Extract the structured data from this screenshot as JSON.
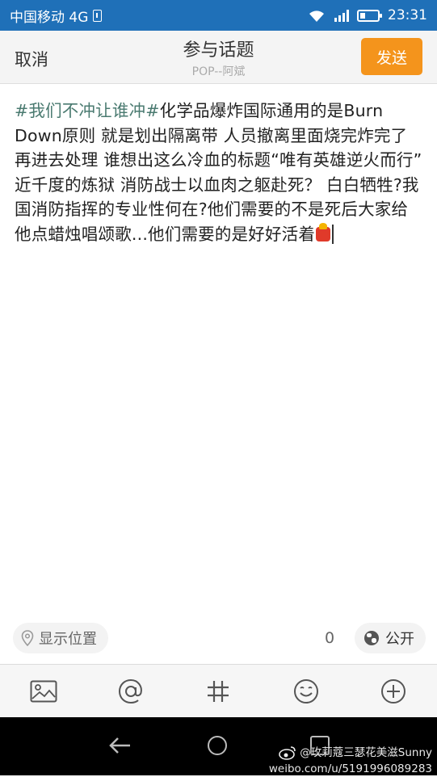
{
  "status_bar": {
    "carrier": "中国移动 4G",
    "network_tag": "4G",
    "time": "23:31",
    "battery_level": 0.3
  },
  "header": {
    "cancel_label": "取消",
    "title": "参与话题",
    "subtitle": "POP--阿斌",
    "send_label": "发送"
  },
  "post": {
    "topic": "#我们不冲让谁冲#",
    "body": "化学品爆炸国际通用的是Burn Down原则 就是划出隔离带 人员撤离里面烧完炸完了再进去处理 谁想出这么冷血的标题“唯有英雄逆火而行” 近千度的炼狱 消防战士以血肉之躯赴死？ 白白牺牲?我国消防指挥的专业性何在?他们需要的不是死后大家给他点蜡烛唱颂歌...他们需要的是好好活着",
    "emoji": "fire-emoji"
  },
  "footer_row": {
    "location_label": "显示位置",
    "count": "0",
    "visibility_label": "公开"
  },
  "toolbar": {
    "icons": [
      "image-icon",
      "mention-icon",
      "hashtag-icon",
      "emoji-icon",
      "add-icon"
    ]
  },
  "watermark": {
    "line1": "@玫莉蔻三瑟花美滋Sunny",
    "line2": "weibo.com/u/5191996089283"
  },
  "colors": {
    "status_bar": "#1f70b8",
    "send_button": "#f4941c",
    "topic_text": "#4a7a70"
  }
}
